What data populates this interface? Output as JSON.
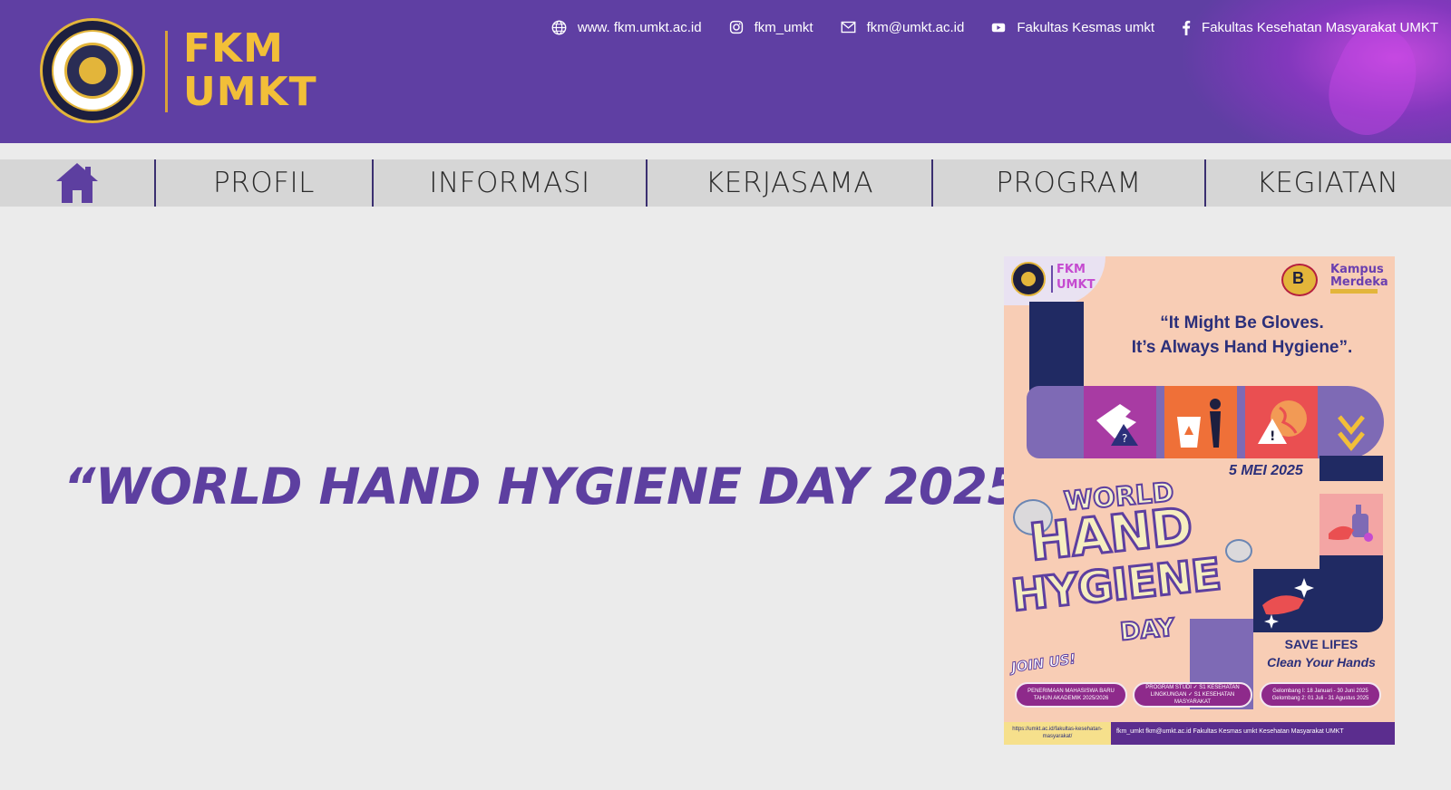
{
  "header": {
    "logo_text_line1": "FKM",
    "logo_text_line2": "UMKT",
    "logo_alt": "Universitas Muhammadiyah Kalimantan Timur",
    "contacts": [
      {
        "icon": "globe-icon",
        "label": "www. fkm.umkt.ac.id"
      },
      {
        "icon": "instagram-icon",
        "label": "fkm_umkt"
      },
      {
        "icon": "mail-icon",
        "label": "fkm@umkt.ac.id"
      },
      {
        "icon": "youtube-icon",
        "label": "Fakultas Kesmas umkt"
      },
      {
        "icon": "facebook-icon",
        "label": "Fakultas Kesehatan Masyarakat UMKT"
      }
    ],
    "colors": {
      "background": "#5f3fa3",
      "logo_text": "#f2bf38"
    }
  },
  "nav": {
    "home_icon": "home-icon",
    "items": [
      "PROFIL",
      "INFORMASI",
      "KERJASAMA",
      "PROGRAM",
      "KEGIATAN"
    ]
  },
  "main": {
    "title": "“WORLD HAND HYGIENE DAY 2025\"",
    "title_color": "#5d3fa0"
  },
  "poster": {
    "logo_text_line1": "FKM",
    "logo_text_line2": "UMKT",
    "badge_letter": "B",
    "kampus_line1": "Kampus",
    "kampus_line2": "Merdeka",
    "quote_line1": "“It Might Be Gloves.",
    "quote_line2": "It’s Always Hand Hygiene”.",
    "date": "5 MEI 2025",
    "headline_world": "WORLD",
    "headline_hand": "HAND",
    "headline_hygiene": "HYGIENE",
    "headline_day": "DAY",
    "save_line1": "SAVE LIFES",
    "save_line2": "Clean Your Hands",
    "join": "JOIN US!",
    "pill1": "PENERIMAAN MAHASISWA BARU TAHUN AKADEMIK 2025/2026",
    "pill2": "PROGRAM STUDI ✓ S1 KESEHATAN LINGKUNGAN ✓ S1 KESEHATAN MASYARAKAT",
    "pill3": "Gelombang I: 18 Januari - 30 Juni 2025 Gelombang 2: 01 Juli - 31 Agustus 2025",
    "footer_url": "https://umkt.ac.id/fakultas-kesehatan-masyarakat/",
    "footer_contacts": "fkm_umkt   fkm@umkt.ac.id   Fakultas Kesmas umkt   Kesehatan Masyarakat UMKT"
  }
}
